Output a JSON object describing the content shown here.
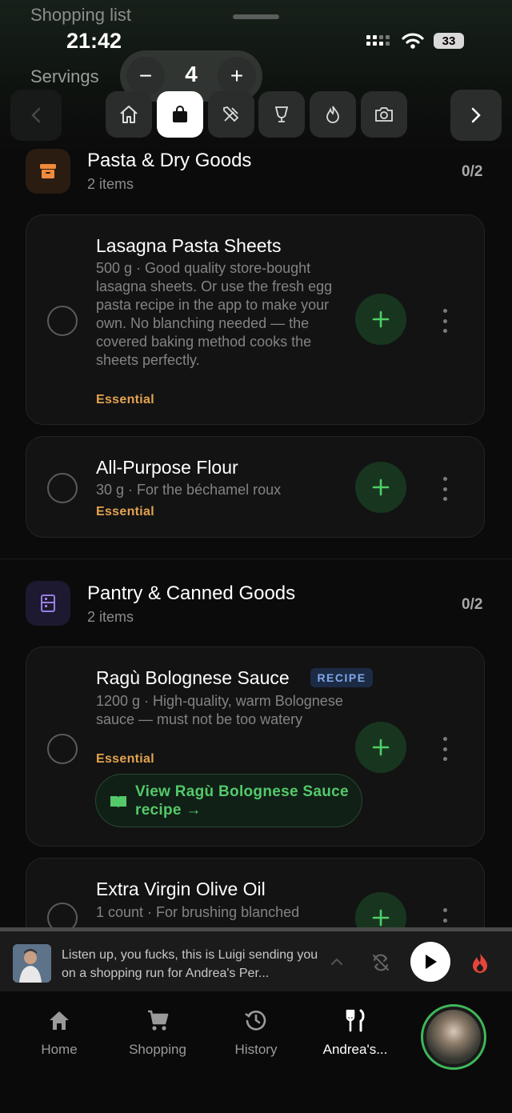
{
  "header": {
    "screen_title": "Shopping list",
    "clock": "21:42",
    "battery": "33",
    "servings_label": "Servings",
    "servings_value": "4",
    "decrement": "−",
    "increment": "+"
  },
  "categories": [
    {
      "icon": "home-icon",
      "active": false
    },
    {
      "icon": "shopping-bag-icon",
      "active": true
    },
    {
      "icon": "tools-icon",
      "active": false
    },
    {
      "icon": "cocktail-glass-icon",
      "active": false
    },
    {
      "icon": "flame-icon",
      "active": false
    },
    {
      "icon": "camera-icon",
      "active": false
    }
  ],
  "sections": [
    {
      "title": "Pasta & Dry Goods",
      "count_label": "2 items",
      "progress": "0/2",
      "icon": "archive-box-icon",
      "accent": "#f08a3c",
      "items": [
        {
          "name": "Lasagna Pasta Sheets",
          "desc": "500 g · Good quality store-bought lasagna sheets. Or use the fresh egg pasta recipe in the app to make your own. No blanching needed — the covered baking method cooks the sheets perfectly.",
          "tag": "Essential"
        },
        {
          "name": "All-Purpose Flour",
          "desc": "30 g · For the béchamel roux",
          "tag": "Essential"
        }
      ]
    },
    {
      "title": "Pantry & Canned Goods",
      "count_label": "2 items",
      "progress": "0/2",
      "icon": "pantry-cabinet-icon",
      "accent": "#9b7fe0",
      "items": [
        {
          "name": "Ragù Bolognese Sauce",
          "badge": "RECIPE",
          "desc": "1200 g · High-quality, warm Bolognese sauce — must not be too watery",
          "tag": "Essential",
          "link": "View Ragù Bolognese Sauce recipe →"
        },
        {
          "name": "Extra Virgin Olive Oil",
          "desc": "1 count · For brushing blanched"
        }
      ]
    }
  ],
  "player": {
    "text": "Listen up, you fucks, this is Luigi sending you on a shopping run for Andrea's Per..."
  },
  "tabs": [
    {
      "label": "Home",
      "icon": "home-icon"
    },
    {
      "label": "Shopping",
      "icon": "cart-icon"
    },
    {
      "label": "History",
      "icon": "history-icon"
    },
    {
      "label": "Andrea's...",
      "icon": "fork-knife-icon"
    }
  ],
  "colors": {
    "accent_green": "#4fcf67",
    "essential_tag": "#e3a34f",
    "recipe_badge": "#7ea7ea"
  }
}
